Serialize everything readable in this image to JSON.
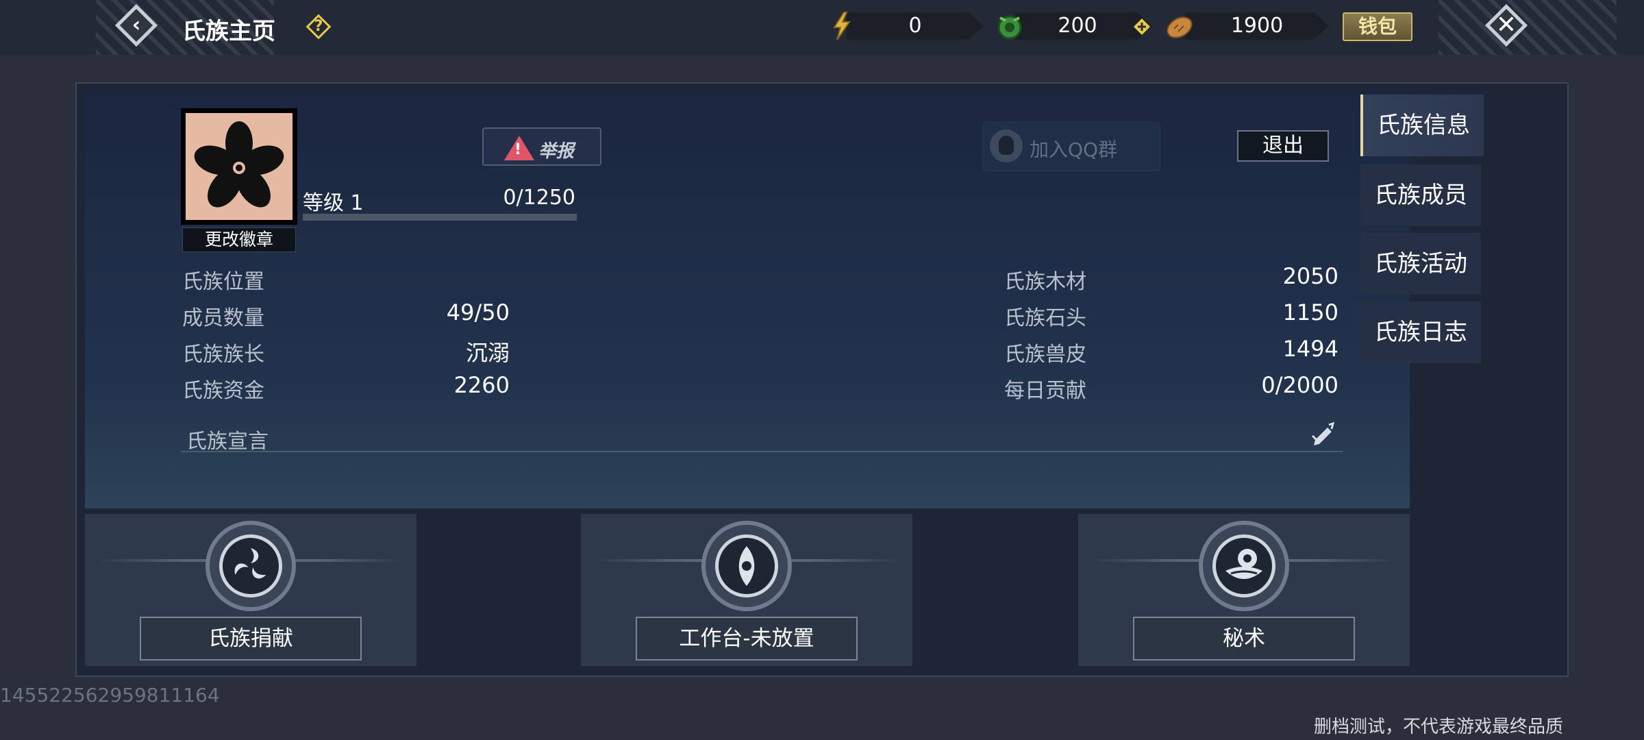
{
  "header": {
    "title": "氏族主页",
    "currencies": [
      {
        "icon": "gold-bolt-icon",
        "value": "0"
      },
      {
        "icon": "green-coin-icon",
        "value": "200"
      },
      {
        "icon": "bread-icon",
        "value": "1900"
      }
    ],
    "wallet_label": "钱包"
  },
  "clan": {
    "level_label": "等级 1",
    "exp": "0/1250",
    "exp_progress": 0,
    "change_emblem_label": "更改徽章",
    "report_label": "举报",
    "join_qq_label": "加入QQ群",
    "exit_label": "退出",
    "left_stats": [
      {
        "label": "氏族位置",
        "value": ""
      },
      {
        "label": "成员数量",
        "value": "49/50"
      },
      {
        "label": "氏族族长",
        "value": "沉溺"
      },
      {
        "label": "氏族资金",
        "value": "2260"
      }
    ],
    "right_stats": [
      {
        "label": "氏族木材",
        "value": "2050"
      },
      {
        "label": "氏族石头",
        "value": "1150"
      },
      {
        "label": "氏族兽皮",
        "value": "1494"
      },
      {
        "label": "每日贡献",
        "value": "0/2000"
      }
    ],
    "declaration_label": "氏族宣言",
    "declaration_text": ""
  },
  "features": [
    {
      "label": "氏族捐献",
      "icon": "swirl-emblem-icon"
    },
    {
      "label": "工作台-未放置",
      "icon": "eye-emblem-icon"
    },
    {
      "label": "秘术",
      "icon": "owl-emblem-icon"
    }
  ],
  "tabs": [
    "氏族信息",
    "氏族成员",
    "氏族活动",
    "氏族日志"
  ],
  "active_tab": "氏族信息",
  "footer": {
    "user_id": "14552256295981116­4",
    "disclaimer": "删档测试，不代表游戏最终品质"
  },
  "colors": {
    "accent_gold": "#e8c94a",
    "report_red": "#e0556a",
    "panel_bg": "#1d2536"
  }
}
